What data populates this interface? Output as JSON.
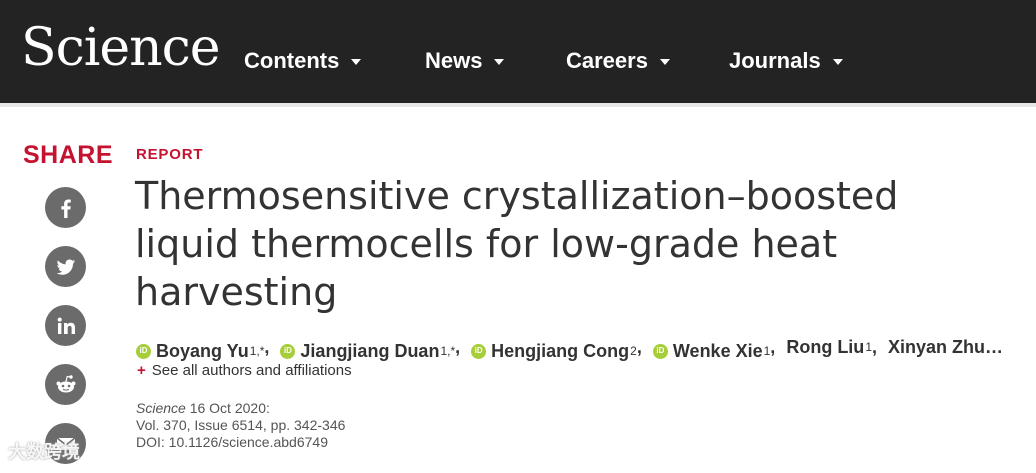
{
  "header": {
    "logo": "Science",
    "nav": [
      {
        "label": "Contents"
      },
      {
        "label": "News"
      },
      {
        "label": "Careers"
      },
      {
        "label": "Journals"
      }
    ]
  },
  "share": {
    "label": "SHARE",
    "buttons": [
      {
        "icon": "facebook-icon"
      },
      {
        "icon": "twitter-icon"
      },
      {
        "icon": "linkedin-icon"
      },
      {
        "icon": "reddit-icon"
      },
      {
        "icon": "email-icon"
      }
    ]
  },
  "article": {
    "type_label": "REPORT",
    "title": "Thermosensitive crystallization–boosted liquid thermocells for low-grade heat harvesting",
    "authors": [
      {
        "name": "Boyang Yu",
        "aff": "1,*",
        "orcid": true
      },
      {
        "name": "Jiangjiang Duan",
        "aff": "1,*",
        "orcid": true
      },
      {
        "name": "Hengjiang Cong",
        "aff": "2",
        "orcid": true
      },
      {
        "name": "Wenke Xie",
        "aff": "1",
        "orcid": true
      },
      {
        "name": "Rong Liu",
        "aff": "1",
        "orcid": false
      },
      {
        "name": "Xinyan Zhu…",
        "aff": "",
        "orcid": false
      }
    ],
    "orcid_badge": "iD",
    "see_all": "See all authors and affiliations",
    "see_all_prefix": "+",
    "citation": {
      "journal": "Science",
      "date": "16 Oct 2020:",
      "volume": "Vol. 370, Issue 6514, pp. 342-346",
      "doi": "DOI: 10.1126/science.abd6749"
    }
  },
  "watermark": "大数跨境",
  "colors": {
    "topbar": "#232323",
    "accent_red": "#c41230",
    "orcid_green": "#a6ce39",
    "share_gray": "#6b6b6b"
  }
}
